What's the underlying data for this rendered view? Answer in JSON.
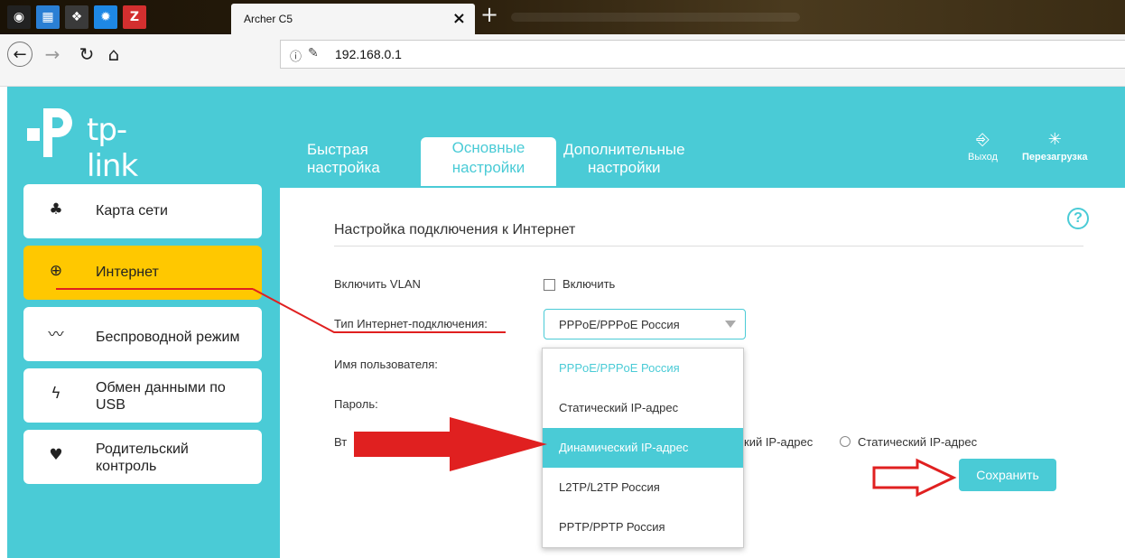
{
  "browser": {
    "tab_title": "Archer C5",
    "tab_close": "×",
    "new_tab": "+",
    "pinned": [
      {
        "icon": "circle-arrow-icon",
        "glyph": "◉",
        "bg": "#222222"
      },
      {
        "icon": "grid-app-icon",
        "glyph": "▦",
        "bg": "#2a7fd4"
      },
      {
        "icon": "photo-app-icon",
        "glyph": "❖",
        "bg": "#3a3a3a"
      },
      {
        "icon": "gear-app-icon",
        "glyph": "✹",
        "bg": "#1e88e5"
      },
      {
        "icon": "z-app-icon",
        "glyph": "Z",
        "bg": "#d32f2f"
      }
    ],
    "back": "←",
    "forward": "→",
    "reload": "↻",
    "home": "⌂",
    "url_info": "ⓘ",
    "url_lock": "✎",
    "url": "192.168.0.1"
  },
  "router": {
    "brand": "tp-link",
    "colors": {
      "accent": "#4acbd6",
      "active_side": "#ffc800"
    },
    "top_nav": [
      {
        "line1": "Быстрая",
        "line2": "настройка"
      },
      {
        "line1": "Основные",
        "line2": "настройки"
      },
      {
        "line1": "Дополнительные",
        "line2": "настройки"
      }
    ],
    "actions": {
      "logout_icon": "⎆",
      "logout": "Выход",
      "reboot_icon": "✳",
      "reboot": "Перезагрузка"
    },
    "sidebar": [
      {
        "icon": "network-map-icon",
        "glyph": "♣",
        "label": "Карта сети"
      },
      {
        "icon": "globe-icon",
        "glyph": "⊕",
        "label": "Интернет"
      },
      {
        "icon": "wifi-icon",
        "glyph": "〰",
        "label": "Беспроводной режим"
      },
      {
        "icon": "usb-icon",
        "glyph": "ϟ",
        "label": "Обмен данными по USB"
      },
      {
        "icon": "heart-icon",
        "glyph": "♥",
        "label": "Родительский контроль"
      }
    ],
    "form": {
      "title": "Настройка подключения к Интернет",
      "help": "?",
      "vlan_label": "Включить VLAN",
      "vlan_checkbox": "Включить",
      "conn_type_label": "Тип Интернет-подключения:",
      "conn_type_value": "PPPoE/PPPoE Россия",
      "username_label": "Имя пользователя:",
      "password_label": "Пароль:",
      "secondary_label": "Вт",
      "radio_dynamic": "кий IP-адрес",
      "radio_static": "Статический IP-адрес",
      "save": "Сохранить"
    },
    "dropdown": [
      "PPPoE/PPPoE Россия",
      "Статический IP-адрес",
      "Динамический IP-адрес",
      "L2TP/L2TP Россия",
      "PPTP/PPTP Россия"
    ]
  }
}
